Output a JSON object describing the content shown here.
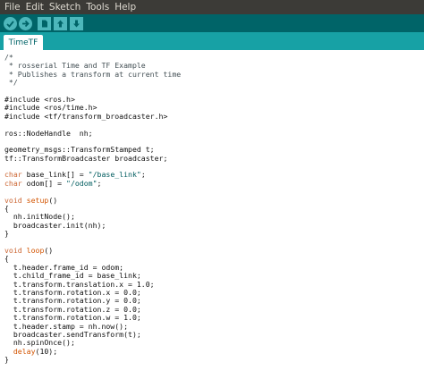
{
  "menu": [
    "File",
    "Edit",
    "Sketch",
    "Tools",
    "Help"
  ],
  "toolbar": {
    "buttons": [
      {
        "name": "verify",
        "icon": "checkmark-icon"
      },
      {
        "name": "upload",
        "icon": "right-arrow-icon"
      },
      {
        "name": "new",
        "icon": "new-file-icon"
      },
      {
        "name": "open",
        "icon": "up-arrow-icon"
      },
      {
        "name": "save",
        "icon": "down-arrow-icon"
      }
    ]
  },
  "tab": {
    "label": "TimeTF"
  },
  "colors": {
    "menubar": "#3c3b37",
    "toolbar": "#006468",
    "tabstrip": "#17a1a5",
    "button": "#4db7bb",
    "keyword": "#cc6633",
    "string": "#005c5f"
  },
  "code_lines": [
    [
      {
        "t": "/*",
        "c": "c-comment"
      }
    ],
    [
      {
        "t": " * rosserial Time and TF Example",
        "c": "c-comment"
      }
    ],
    [
      {
        "t": " * Publishes a transform at current time",
        "c": "c-comment"
      }
    ],
    [
      {
        "t": " */",
        "c": "c-comment"
      }
    ],
    [],
    [
      {
        "t": "#include <ros.h>",
        "c": ""
      }
    ],
    [
      {
        "t": "#include <ros/time.h>",
        "c": ""
      }
    ],
    [
      {
        "t": "#include <tf/transform_broadcaster.h>",
        "c": ""
      }
    ],
    [],
    [
      {
        "t": "ros::NodeHandle  nh;",
        "c": ""
      }
    ],
    [],
    [
      {
        "t": "geometry_msgs::TransformStamped t;",
        "c": ""
      }
    ],
    [
      {
        "t": "tf::TransformBroadcaster broadcaster;",
        "c": ""
      }
    ],
    [],
    [
      {
        "t": "char",
        "c": "c-type"
      },
      {
        "t": " base_link[] = ",
        "c": ""
      },
      {
        "t": "\"/base_link\"",
        "c": "c-string"
      },
      {
        "t": ";",
        "c": ""
      }
    ],
    [
      {
        "t": "char",
        "c": "c-type"
      },
      {
        "t": " odom[] = ",
        "c": ""
      },
      {
        "t": "\"/odom\"",
        "c": "c-string"
      },
      {
        "t": ";",
        "c": ""
      }
    ],
    [],
    [
      {
        "t": "void",
        "c": "c-type"
      },
      {
        "t": " ",
        "c": ""
      },
      {
        "t": "setup",
        "c": "c-func"
      },
      {
        "t": "()",
        "c": ""
      }
    ],
    [
      {
        "t": "{",
        "c": ""
      }
    ],
    [
      {
        "t": "  nh.initNode();",
        "c": ""
      }
    ],
    [
      {
        "t": "  broadcaster.init(nh);",
        "c": ""
      }
    ],
    [
      {
        "t": "}",
        "c": ""
      }
    ],
    [],
    [
      {
        "t": "void",
        "c": "c-type"
      },
      {
        "t": " ",
        "c": ""
      },
      {
        "t": "loop",
        "c": "c-func"
      },
      {
        "t": "()",
        "c": ""
      }
    ],
    [
      {
        "t": "{",
        "c": ""
      }
    ],
    [
      {
        "t": "  t.header.frame_id = odom;",
        "c": ""
      }
    ],
    [
      {
        "t": "  t.child_frame_id = base_link;",
        "c": ""
      }
    ],
    [
      {
        "t": "  t.transform.translation.x = 1.0;",
        "c": ""
      }
    ],
    [
      {
        "t": "  t.transform.rotation.x = 0.0;",
        "c": ""
      }
    ],
    [
      {
        "t": "  t.transform.rotation.y = 0.0;",
        "c": ""
      }
    ],
    [
      {
        "t": "  t.transform.rotation.z = 0.0;",
        "c": ""
      }
    ],
    [
      {
        "t": "  t.transform.rotation.w = 1.0;",
        "c": ""
      }
    ],
    [
      {
        "t": "  t.header.stamp = nh.now();",
        "c": ""
      }
    ],
    [
      {
        "t": "  broadcaster.sendTransform(t);",
        "c": ""
      }
    ],
    [
      {
        "t": "  nh.spinOnce();",
        "c": ""
      }
    ],
    [
      {
        "t": "  ",
        "c": ""
      },
      {
        "t": "delay",
        "c": "c-func"
      },
      {
        "t": "(10);",
        "c": ""
      }
    ],
    [
      {
        "t": "}",
        "c": ""
      }
    ]
  ]
}
